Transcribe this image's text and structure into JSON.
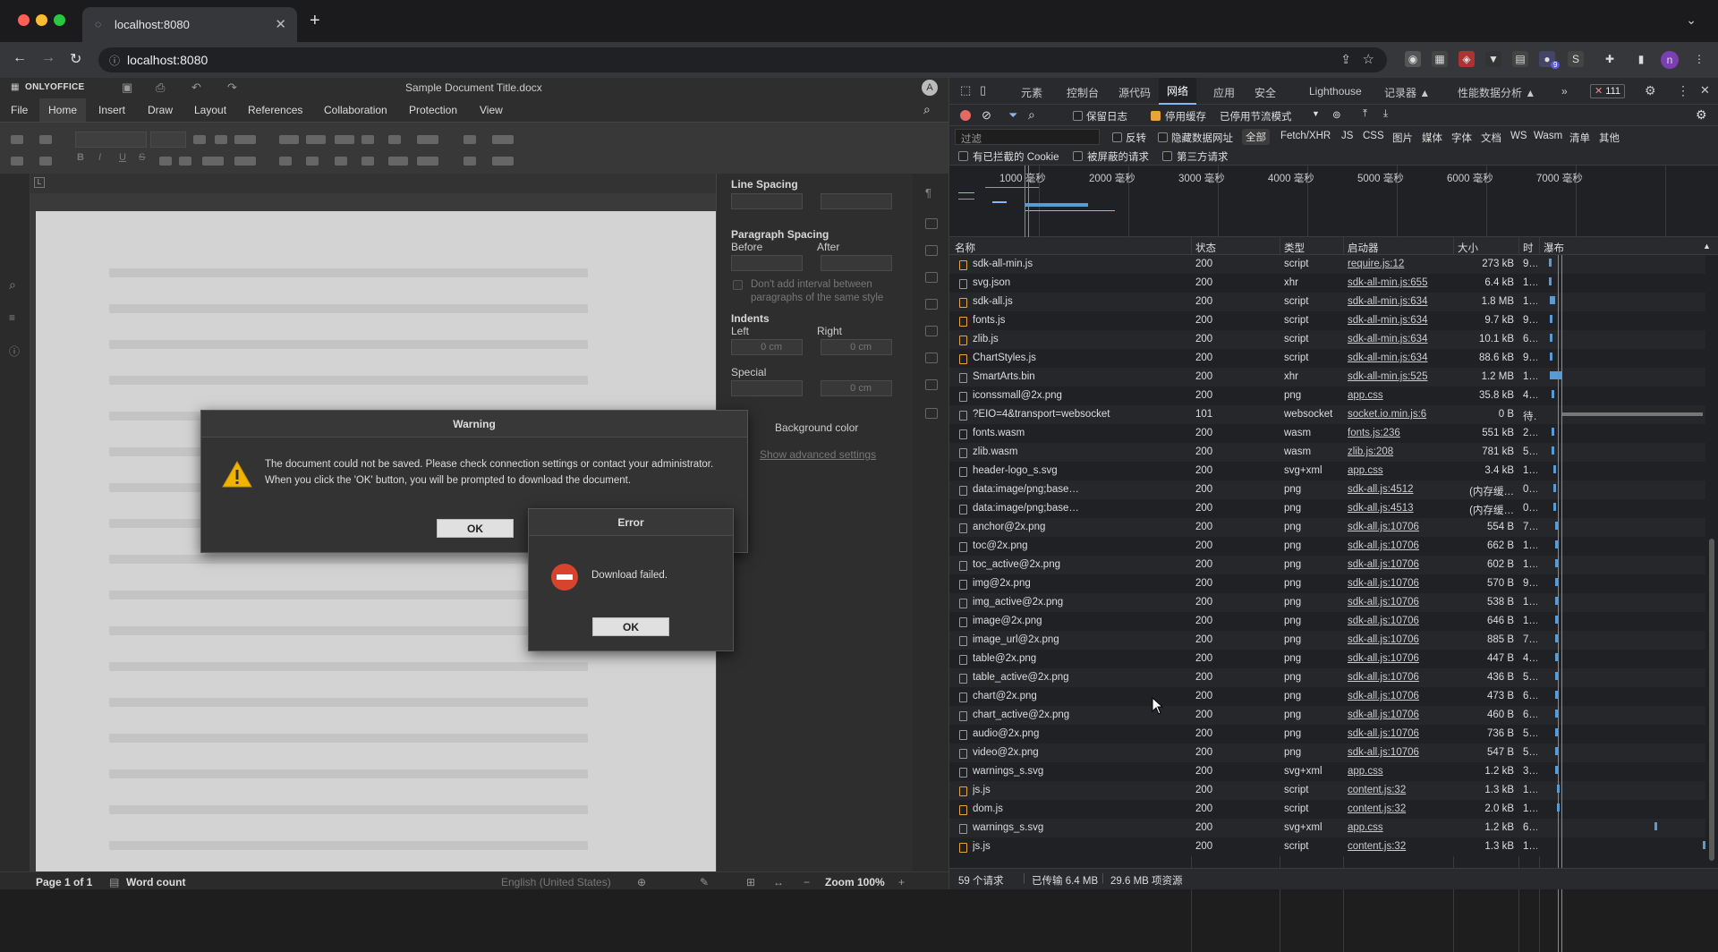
{
  "browser": {
    "tab_title": "localhost:8080",
    "url": "localhost:8080",
    "ext_badge": "9",
    "profile_initial": "n"
  },
  "editor": {
    "brand": "ONLYOFFICE",
    "doc_title": "Sample Document Title.docx",
    "user_initial": "A",
    "menu": [
      "File",
      "Home",
      "Insert",
      "Draw",
      "Layout",
      "References",
      "Collaboration",
      "Protection",
      "View"
    ],
    "active_menu": "Home",
    "panel": {
      "line_spacing": "Line Spacing",
      "paragraph_spacing": "Paragraph Spacing",
      "before": "Before",
      "after": "After",
      "dont_add": "Don't add interval between paragraphs of the same style",
      "indents": "Indents",
      "left": "Left",
      "right": "Right",
      "left_val": "0 cm",
      "right_val": "0 cm",
      "special": "Special",
      "special_val": "0 cm",
      "background_color": "Background color",
      "show_advanced": "Show advanced settings"
    },
    "status": {
      "page": "Page 1 of 1",
      "word_count": "Word count",
      "language": "English (United States)",
      "zoom": "Zoom 100%"
    }
  },
  "warning_dialog": {
    "title": "Warning",
    "line1": "The document could not be saved. Please check connection settings or contact your administrator.",
    "line2": "When you click the 'OK' button, you will be prompted to download the document.",
    "ok": "OK"
  },
  "error_dialog": {
    "title": "Error",
    "message": "Download failed.",
    "ok": "OK"
  },
  "devtools": {
    "tabs": [
      "元素",
      "控制台",
      "源代码",
      "网络",
      "应用",
      "安全",
      "Lighthouse",
      "记录器 ▲",
      "性能数据分析 ▲"
    ],
    "active_tab": "网络",
    "error_badge": "111",
    "toolbar": {
      "preserve_log": "保留日志",
      "disable_cache": "停用缓存",
      "throttle": "已停用节流模式"
    },
    "filter": {
      "placeholder": "过滤",
      "invert": "反转",
      "hide_data_urls": "隐藏数据网址",
      "types": [
        "全部",
        "Fetch/XHR",
        "JS",
        "CSS",
        "图片",
        "媒体",
        "字体",
        "文档",
        "WS",
        "Wasm",
        "清单",
        "其他"
      ],
      "blocked_cookies": "有已拦截的 Cookie",
      "blocked_requests": "被屏蔽的请求",
      "third_party": "第三方请求"
    },
    "overview_ticks": [
      "1000 毫秒",
      "2000 毫秒",
      "3000 毫秒",
      "4000 毫秒",
      "5000 毫秒",
      "6000 毫秒",
      "7000 毫秒"
    ],
    "columns": [
      "名称",
      "状态",
      "类型",
      "启动器",
      "大小",
      "时",
      "瀑布"
    ],
    "rows": [
      {
        "name": "sdk-all-min.js",
        "status": "200",
        "type": "script",
        "initiator": "require.js:12",
        "size": "273 kB",
        "time": "9…",
        "wf": 0.02
      },
      {
        "name": "svg.json",
        "status": "200",
        "type": "xhr",
        "initiator": "sdk-all-min.js:655",
        "size": "6.4 kB",
        "time": "1…",
        "wf": 0.02
      },
      {
        "name": "sdk-all.js",
        "status": "200",
        "type": "script",
        "initiator": "sdk-all-min.js:634",
        "size": "1.8 MB",
        "wf": 0.03,
        "time": "1…"
      },
      {
        "name": "fonts.js",
        "status": "200",
        "type": "script",
        "initiator": "sdk-all-min.js:634",
        "size": "9.7 kB",
        "time": "9…",
        "wf": 0.03
      },
      {
        "name": "zlib.js",
        "status": "200",
        "type": "script",
        "initiator": "sdk-all-min.js:634",
        "size": "10.1 kB",
        "time": "6…",
        "wf": 0.03
      },
      {
        "name": "ChartStyles.js",
        "status": "200",
        "type": "script",
        "initiator": "sdk-all-min.js:634",
        "size": "88.6 kB",
        "time": "9…",
        "wf": 0.03
      },
      {
        "name": "SmartArts.bin",
        "status": "200",
        "type": "xhr",
        "initiator": "sdk-all-min.js:525",
        "size": "1.2 MB",
        "time": "1…",
        "wf": 0.03
      },
      {
        "name": "iconssmall@2x.png",
        "status": "200",
        "type": "png",
        "initiator": "app.css",
        "size": "35.8 kB",
        "time": "4…",
        "wf": 0.04
      },
      {
        "name": "?EIO=4&transport=websocket",
        "status": "101",
        "type": "websocket",
        "initiator": "socket.io.min.js:6",
        "size": "0 B",
        "time": "待…",
        "wf": 0.04
      },
      {
        "name": "fonts.wasm",
        "status": "200",
        "type": "wasm",
        "initiator": "fonts.js:236",
        "size": "551 kB",
        "time": "2…",
        "wf": 0.04
      },
      {
        "name": "zlib.wasm",
        "status": "200",
        "type": "wasm",
        "initiator": "zlib.js:208",
        "size": "781 kB",
        "time": "5…",
        "wf": 0.04
      },
      {
        "name": "header-logo_s.svg",
        "status": "200",
        "type": "svg+xml",
        "initiator": "app.css",
        "size": "3.4 kB",
        "time": "1…",
        "wf": 0.05
      },
      {
        "name": "data:image/png;base…",
        "status": "200",
        "type": "png",
        "initiator": "sdk-all.js:4512",
        "size": "(内存缓…",
        "time": "0…",
        "wf": 0.05
      },
      {
        "name": "data:image/png;base…",
        "status": "200",
        "type": "png",
        "initiator": "sdk-all.js:4513",
        "size": "(内存缓…",
        "time": "0…",
        "wf": 0.05
      },
      {
        "name": "anchor@2x.png",
        "status": "200",
        "type": "png",
        "initiator": "sdk-all.js:10706",
        "size": "554 B",
        "time": "7…",
        "wf": 0.06
      },
      {
        "name": "toc@2x.png",
        "status": "200",
        "type": "png",
        "initiator": "sdk-all.js:10706",
        "size": "662 B",
        "time": "1…",
        "wf": 0.06
      },
      {
        "name": "toc_active@2x.png",
        "status": "200",
        "type": "png",
        "initiator": "sdk-all.js:10706",
        "size": "602 B",
        "time": "1…",
        "wf": 0.06
      },
      {
        "name": "img@2x.png",
        "status": "200",
        "type": "png",
        "initiator": "sdk-all.js:10706",
        "size": "570 B",
        "time": "9…",
        "wf": 0.06
      },
      {
        "name": "img_active@2x.png",
        "status": "200",
        "type": "png",
        "initiator": "sdk-all.js:10706",
        "size": "538 B",
        "time": "1…",
        "wf": 0.06
      },
      {
        "name": "image@2x.png",
        "status": "200",
        "type": "png",
        "initiator": "sdk-all.js:10706",
        "size": "646 B",
        "time": "1…",
        "wf": 0.06
      },
      {
        "name": "image_url@2x.png",
        "status": "200",
        "type": "png",
        "initiator": "sdk-all.js:10706",
        "size": "885 B",
        "time": "7…",
        "wf": 0.06
      },
      {
        "name": "table@2x.png",
        "status": "200",
        "type": "png",
        "initiator": "sdk-all.js:10706",
        "size": "447 B",
        "time": "4…",
        "wf": 0.06
      },
      {
        "name": "table_active@2x.png",
        "status": "200",
        "type": "png",
        "initiator": "sdk-all.js:10706",
        "size": "436 B",
        "time": "5…",
        "wf": 0.06
      },
      {
        "name": "chart@2x.png",
        "status": "200",
        "type": "png",
        "initiator": "sdk-all.js:10706",
        "size": "473 B",
        "time": "6…",
        "wf": 0.06
      },
      {
        "name": "chart_active@2x.png",
        "status": "200",
        "type": "png",
        "initiator": "sdk-all.js:10706",
        "size": "460 B",
        "time": "6…",
        "wf": 0.06
      },
      {
        "name": "audio@2x.png",
        "status": "200",
        "type": "png",
        "initiator": "sdk-all.js:10706",
        "size": "736 B",
        "time": "5…",
        "wf": 0.06
      },
      {
        "name": "video@2x.png",
        "status": "200",
        "type": "png",
        "initiator": "sdk-all.js:10706",
        "size": "547 B",
        "time": "5…",
        "wf": 0.06
      },
      {
        "name": "warnings_s.svg",
        "status": "200",
        "type": "svg+xml",
        "initiator": "app.css",
        "size": "1.2 kB",
        "time": "3…",
        "wf": 0.06
      },
      {
        "name": "js.js",
        "status": "200",
        "type": "script",
        "initiator": "content.js:32",
        "size": "1.3 kB",
        "time": "1…",
        "wf": 0.07
      },
      {
        "name": "dom.js",
        "status": "200",
        "type": "script",
        "initiator": "content.js:32",
        "size": "2.0 kB",
        "time": "1…",
        "wf": 0.07
      },
      {
        "name": "warnings_s.svg",
        "status": "200",
        "type": "svg+xml",
        "initiator": "app.css",
        "size": "1.2 kB",
        "time": "6…",
        "wf": 0.68
      },
      {
        "name": "js.js",
        "status": "200",
        "type": "script",
        "initiator": "content.js:32",
        "size": "1.3 kB",
        "time": "1…",
        "wf": 0.98
      }
    ],
    "status_bar": {
      "requests": "59 个请求",
      "transferred": "已传输 6.4 MB",
      "resources": "29.6 MB 项资源"
    }
  }
}
